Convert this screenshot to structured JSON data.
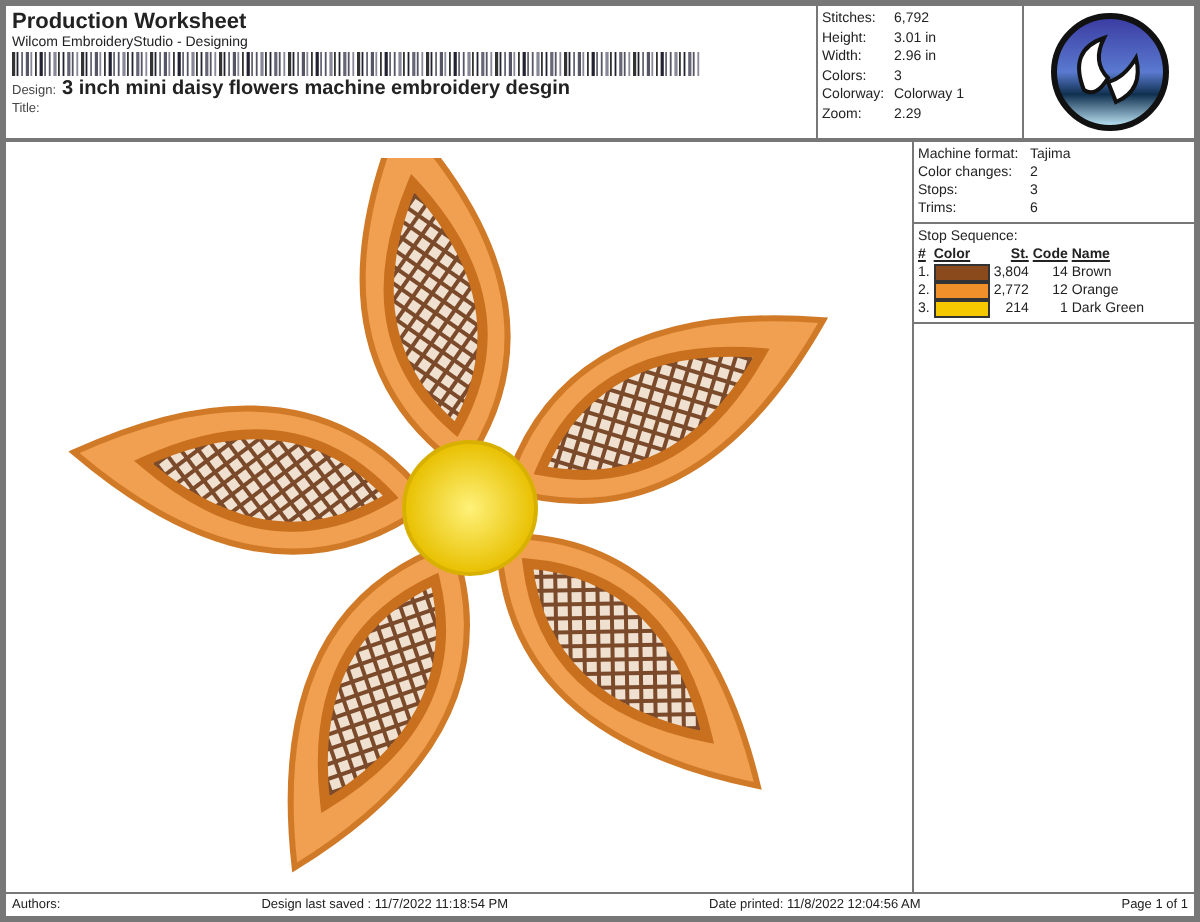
{
  "header": {
    "title": "Production Worksheet",
    "subtitle": "Wilcom EmbroideryStudio - Designing",
    "design_label": "Design:",
    "design_name": "3 inch mini daisy flowers machine embroidery desgin",
    "title_label": "Title:"
  },
  "stats": [
    {
      "label": "Stitches:",
      "value": "6,792"
    },
    {
      "label": "Height:",
      "value": "3.01 in"
    },
    {
      "label": "Width:",
      "value": "2.96 in"
    },
    {
      "label": "Colors:",
      "value": "3"
    },
    {
      "label": "Colorway:",
      "value": "Colorway 1"
    },
    {
      "label": "Zoom:",
      "value": "2.29"
    }
  ],
  "machine": [
    {
      "label": "Machine format:",
      "value": "Tajima"
    },
    {
      "label": "Color changes:",
      "value": "2"
    },
    {
      "label": "Stops:",
      "value": "3"
    },
    {
      "label": "Trims:",
      "value": "6"
    }
  ],
  "stop_sequence": {
    "title": "Stop Sequence:",
    "columns": [
      "#",
      "Color",
      "St.",
      "Code",
      "Name"
    ],
    "rows": [
      {
        "index": "1.",
        "color": "#8b4a1c",
        "stitches": "3,804",
        "code": "14",
        "name": "Brown"
      },
      {
        "index": "2.",
        "color": "#f0902a",
        "stitches": "2,772",
        "code": "12",
        "name": "Orange"
      },
      {
        "index": "3.",
        "color": "#f5c800",
        "stitches": "214",
        "code": "1",
        "name": "Dark Green"
      }
    ]
  },
  "footer": {
    "authors": "Authors:",
    "saved": "Design last saved : 11/7/2022 11:18:54 PM",
    "printed": "Date printed: 11/8/2022 12:04:56 AM",
    "page": "Page 1 of 1"
  }
}
